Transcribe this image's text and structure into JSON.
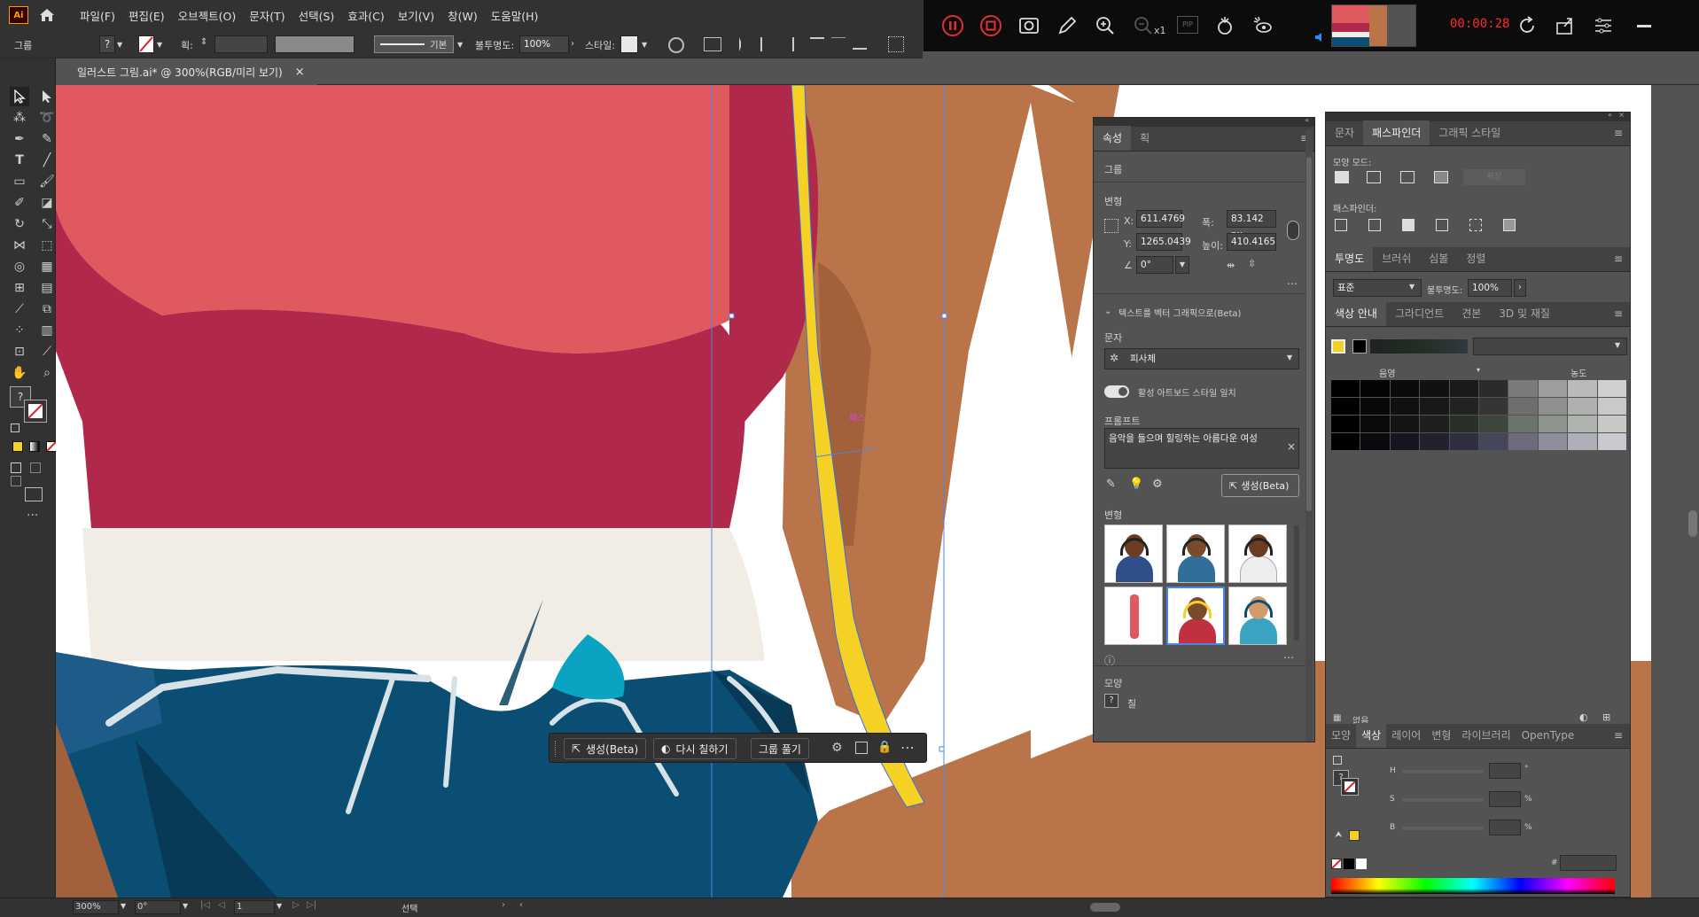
{
  "app": {
    "logo": "Ai",
    "home_icon": "home-icon"
  },
  "menu": [
    "파일(F)",
    "편집(E)",
    "오브젝트(O)",
    "문자(T)",
    "선택(S)",
    "효과(C)",
    "보기(V)",
    "창(W)",
    "도움말(H)"
  ],
  "recorder": {
    "time": "00:00:28",
    "zoom_label": "x1",
    "pip_label": "PIP"
  },
  "control_bar": {
    "selection_label": "그룹",
    "stroke_label": "획:",
    "stroke_style": "기본",
    "opacity_label": "불투명도:",
    "opacity_value": "100%",
    "style_label": "스타일:"
  },
  "document": {
    "tab_title": "일러스트 그림.ai* @ 300%(RGB/미리 보기)",
    "close": "×"
  },
  "canvas": {
    "path_label": "패스"
  },
  "context_bar": {
    "generate": "생성(Beta)",
    "recolor": "다시 칠하기",
    "ungroup": "그룹 풀기"
  },
  "properties_panel": {
    "tabs": [
      "속성",
      "획"
    ],
    "selection": "그룹",
    "transform_title": "변형",
    "x_label": "X:",
    "x_value": "611.4769",
    "w_label": "폭:",
    "w_value": "83.142 px",
    "y_label": "Y:",
    "y_value": "1265.0439",
    "h_label": "높이:",
    "h_value": "410.4165",
    "angle_value": "0°",
    "text_to_vector_title": "텍스트를 벡터 그래픽으로(Beta)",
    "type_label": "문자",
    "type_value": "피사체",
    "match_style_label": "활성 아트보드 스타일 일치",
    "prompt_label": "프롬프트",
    "prompt_value": "음악을 들으며 힐링하는 아름다운  여성",
    "generate_button": "생성(Beta)",
    "variations_label": "변형",
    "appearance_label": "모양",
    "fill_label": "칠"
  },
  "pathfinder_panel": {
    "tabs": [
      "문자",
      "패스파인더",
      "그래픽 스타일"
    ],
    "shape_modes_label": "모양 모드:",
    "expand_label": "확장",
    "pathfinders_label": "패스파인더:"
  },
  "transparency_panel": {
    "tabs": [
      "투명도",
      "브러쉬",
      "심볼",
      "정렬"
    ],
    "blend_mode": "표준",
    "opacity_label": "불투명도:",
    "opacity_value": "100%"
  },
  "color_guide_panel": {
    "tabs": [
      "색상 안내",
      "그라디언트",
      "견본",
      "3D 및 재질"
    ],
    "shade_label": "음영",
    "tint_label": "농도",
    "footer_label": "없음",
    "grid_colors": [
      [
        "#000000",
        "#050505",
        "#0a0a0a",
        "#111111",
        "#1a1a1a",
        "#2b2b2b",
        "#7a7a7a",
        "#9d9d9d",
        "#bababa",
        "#d0d0d0"
      ],
      [
        "#000000",
        "#080808",
        "#101010",
        "#181818",
        "#232323",
        "#353535",
        "#6e6e6e",
        "#8f8f8f",
        "#b0b0b0",
        "#c9c9c9"
      ],
      [
        "#000000",
        "#0a0a0a",
        "#141414",
        "#1d201d",
        "#283028",
        "#3c463c",
        "#6b746b",
        "#8d948d",
        "#aeb3ae",
        "#c7c9c7"
      ],
      [
        "#000000",
        "#0b0b0f",
        "#161620",
        "#22222e",
        "#2e2e3e",
        "#46465a",
        "#6c6c7c",
        "#8e8e9c",
        "#afafba",
        "#c9c9d0"
      ]
    ]
  },
  "color_panel": {
    "tabs": [
      "모양",
      "색상",
      "레이어",
      "변형",
      "라이브러리",
      "OpenType"
    ],
    "h_label": "H",
    "s_label": "S",
    "b_label": "B",
    "h_unit": "°",
    "s_unit": "%",
    "b_unit": "%",
    "hex_label": "#"
  },
  "status_bar": {
    "zoom": "300%",
    "rotation": "0°",
    "artboard": "1",
    "tool": "선택"
  },
  "colors": {
    "ui_dark": "#323232",
    "ui_mid": "#535353",
    "accent_yellow": "#f6d125",
    "skin": "#b9744a",
    "shirt_red": "#b0294a",
    "shirt_pink": "#e0595f",
    "jeans": "#0a4f73",
    "cream": "#f1ede4"
  }
}
